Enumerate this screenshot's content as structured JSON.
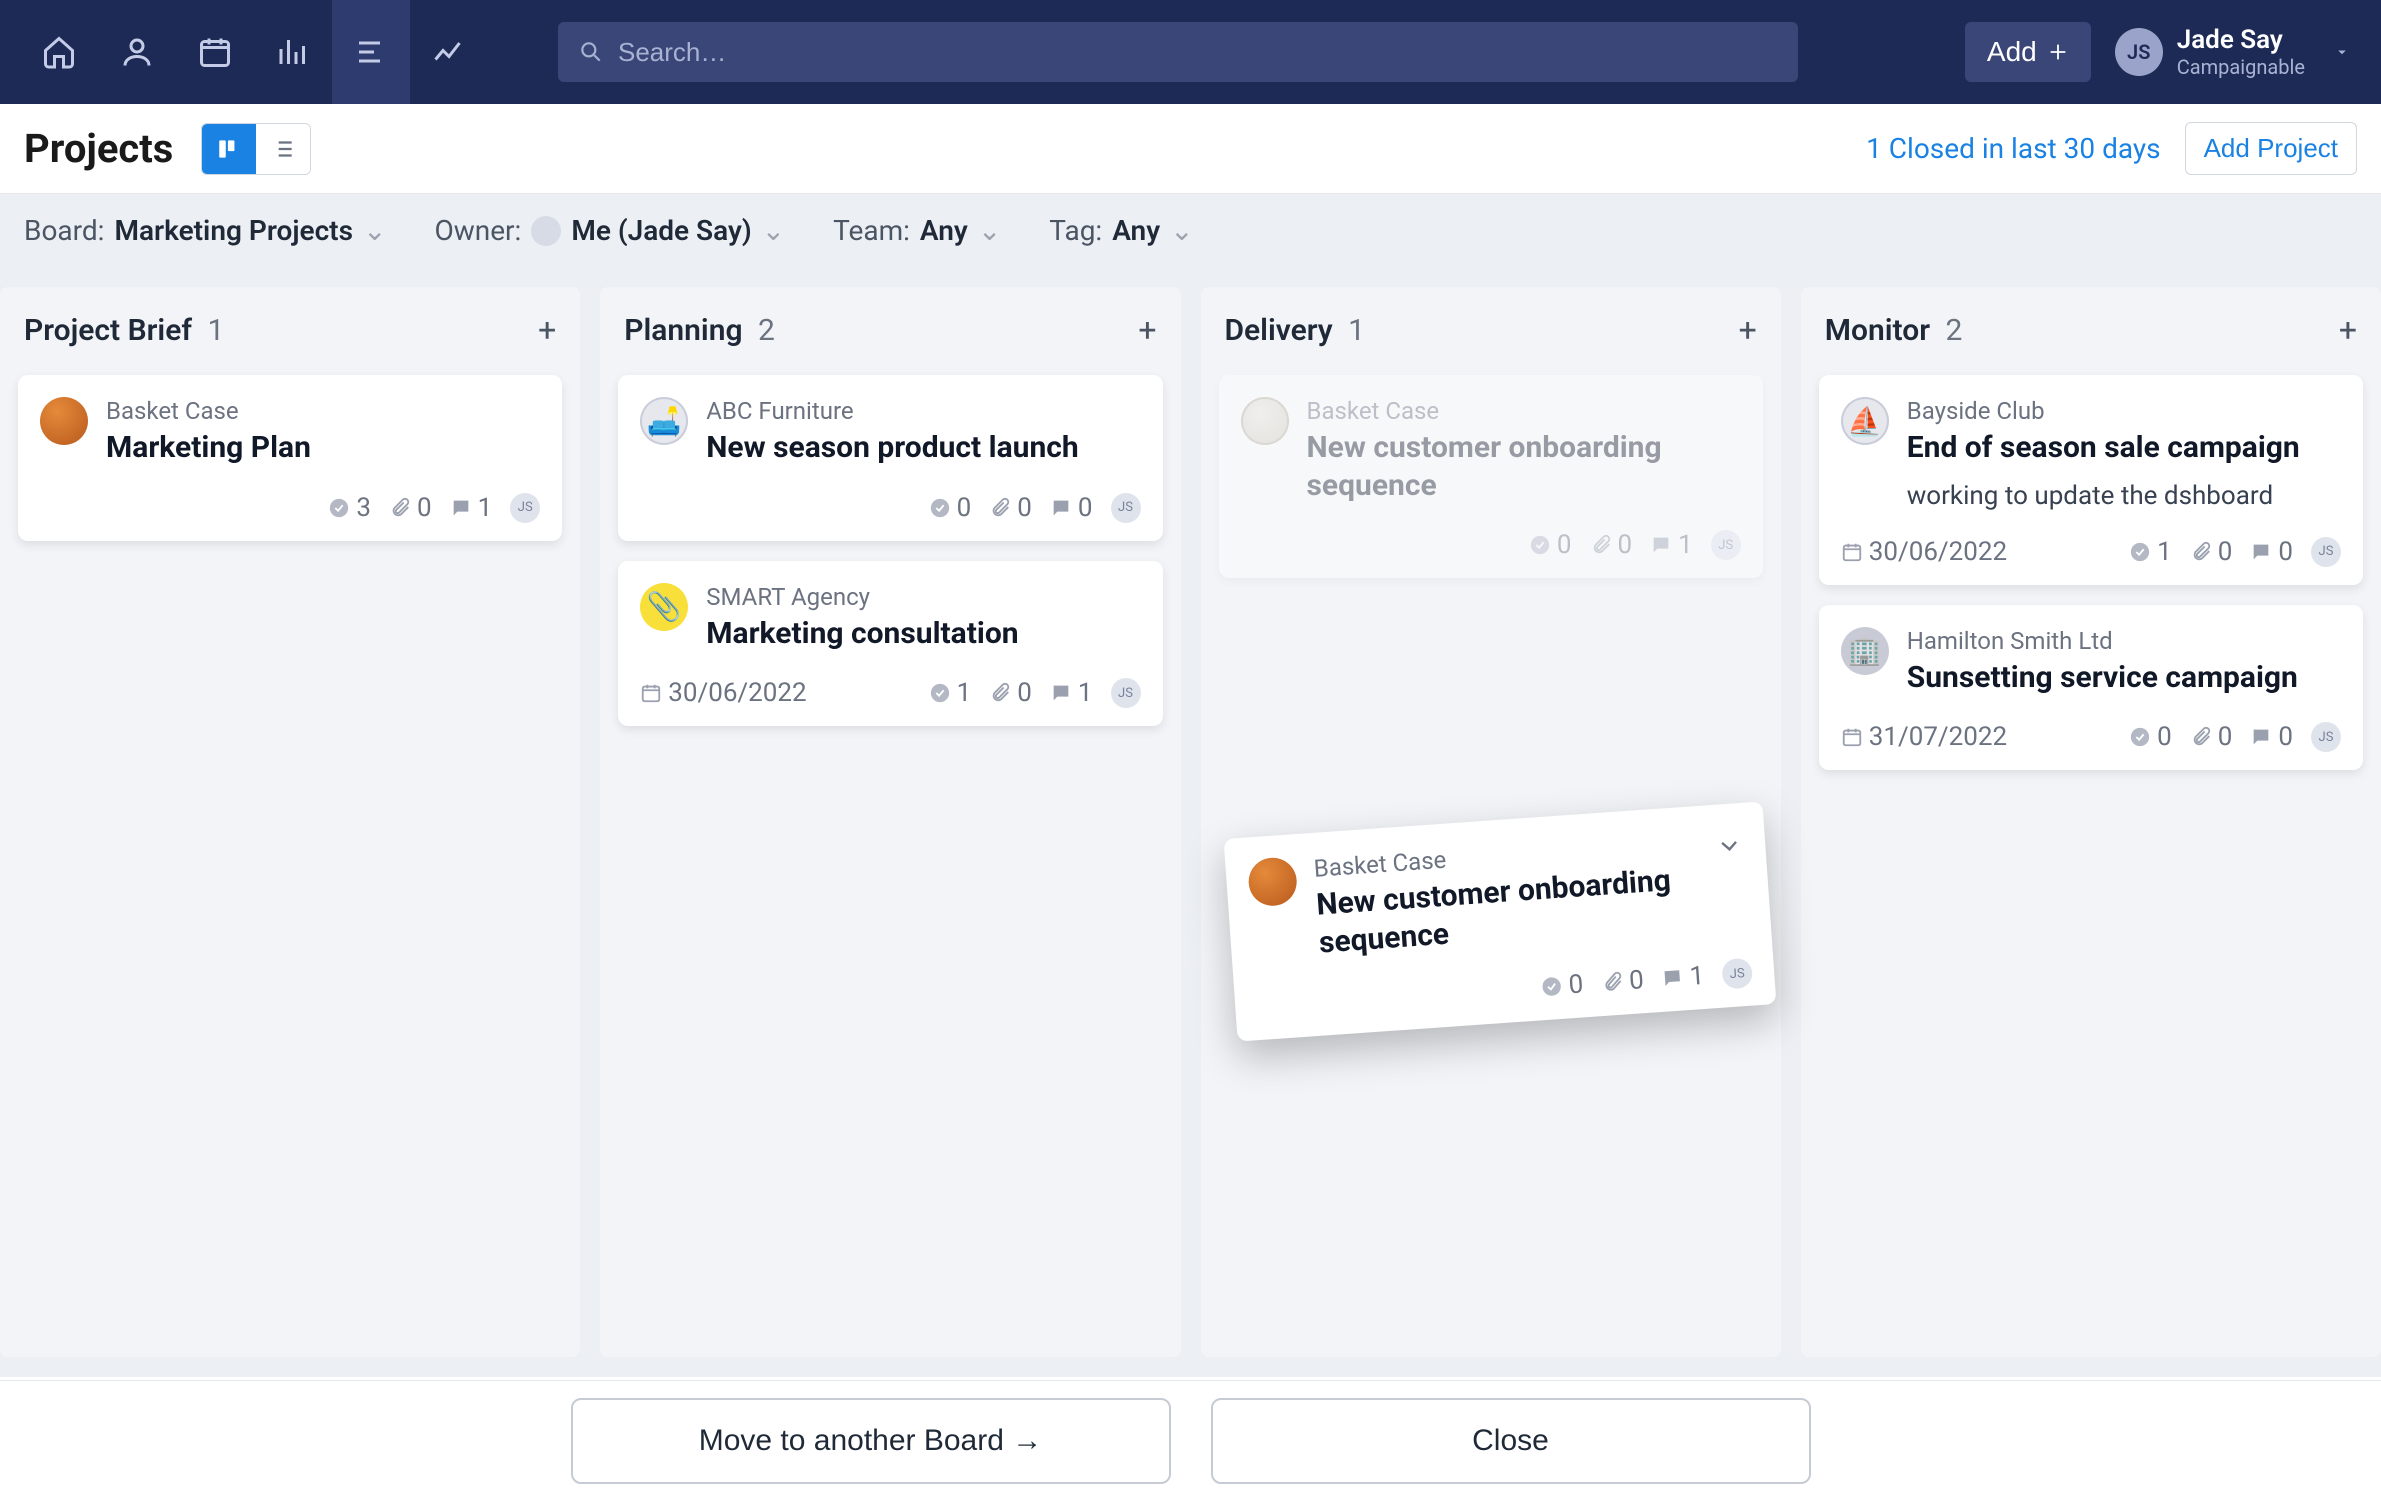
{
  "nav": {
    "add_label": "Add",
    "search_placeholder": "Search…",
    "user_initials": "JS",
    "user_name": "Jade Say",
    "user_org": "Campaignable"
  },
  "header": {
    "title": "Projects",
    "closed_link": "1 Closed in last 30 days",
    "add_project": "Add Project"
  },
  "filters": {
    "board_label": "Board:",
    "board_value": "Marketing Projects",
    "owner_label": "Owner:",
    "owner_value": "Me (Jade Say)",
    "team_label": "Team:",
    "team_value": "Any",
    "tag_label": "Tag:",
    "tag_value": "Any"
  },
  "columns": [
    {
      "title": "Project Brief",
      "count": "1",
      "cards": [
        {
          "client": "Basket Case",
          "name": "Marketing Plan",
          "icon": "ic-orange",
          "checks": "3",
          "attachments": "0",
          "comments": "1"
        }
      ]
    },
    {
      "title": "Planning",
      "count": "2",
      "cards": [
        {
          "client": "ABC Furniture",
          "name": "New season product launch",
          "icon": "ic-grey",
          "icon_glyph": "🛋️",
          "checks": "0",
          "attachments": "0",
          "comments": "0"
        },
        {
          "client": "SMART Agency",
          "name": "Marketing consultation",
          "icon": "ic-yellow",
          "icon_glyph": "📎",
          "date": "30/06/2022",
          "checks": "1",
          "attachments": "0",
          "comments": "1"
        }
      ]
    },
    {
      "title": "Delivery",
      "count": "1",
      "cards": [
        {
          "client": "Basket Case",
          "name": "New customer onboarding sequence",
          "icon": "ic-ball",
          "ghost": true,
          "checks": "0",
          "attachments": "0",
          "comments": "1"
        }
      ]
    },
    {
      "title": "Monitor",
      "count": "2",
      "cards": [
        {
          "client": "Bayside Club",
          "name": "End of season sale campaign",
          "note": "working to update the dshboard",
          "icon": "ic-grey",
          "icon_glyph": "⛵",
          "date": "30/06/2022",
          "checks": "1",
          "attachments": "0",
          "comments": "0"
        },
        {
          "client": "Hamilton Smith Ltd",
          "name": "Sunsetting service campaign",
          "icon": "ic-grey-sq",
          "icon_glyph": "🏢",
          "date": "31/07/2022",
          "checks": "0",
          "attachments": "0",
          "comments": "0"
        }
      ]
    }
  ],
  "drag_card": {
    "client": "Basket Case",
    "name": "New customer onboarding sequence",
    "checks": "0",
    "attachments": "0",
    "comments": "1"
  },
  "actions": {
    "move": "Move to another Board →",
    "close": "Close"
  }
}
